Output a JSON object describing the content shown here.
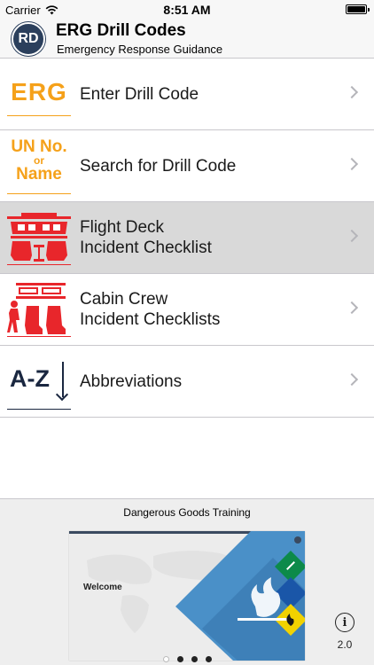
{
  "status_bar": {
    "carrier": "Carrier",
    "time": "8:51 AM"
  },
  "header": {
    "logo_text": "RD",
    "title": "ERG Drill Codes",
    "subtitle": "Emergency Response Guidance"
  },
  "menu": [
    {
      "label_lines": [
        "Enter Drill Code"
      ],
      "icon": "erg-icon",
      "icon_text": "ERG",
      "selected": false
    },
    {
      "label_lines": [
        "Search for Drill Code"
      ],
      "icon": "un-name-icon",
      "icon_text": [
        "UN No.",
        "or",
        "Name"
      ],
      "selected": false
    },
    {
      "label_lines": [
        "Flight Deck",
        "Incident Checklist"
      ],
      "icon": "flight-deck-icon",
      "selected": true
    },
    {
      "label_lines": [
        "Cabin Crew",
        "Incident Checklists"
      ],
      "icon": "cabin-crew-icon",
      "selected": false
    },
    {
      "label_lines": [
        "Abbreviations"
      ],
      "icon": "abbreviations-icon",
      "icon_text": "A-Z",
      "selected": false
    }
  ],
  "promo": {
    "title": "Dangerous Goods Training",
    "slide": {
      "welcome": "Welcome"
    },
    "version": "2.0",
    "page_count": 4,
    "active_page": 1
  },
  "colors": {
    "accent_orange": "#f5a11a",
    "accent_red": "#e8262b",
    "navy": "#1a2740",
    "selected_row": "#d9d9d9"
  }
}
